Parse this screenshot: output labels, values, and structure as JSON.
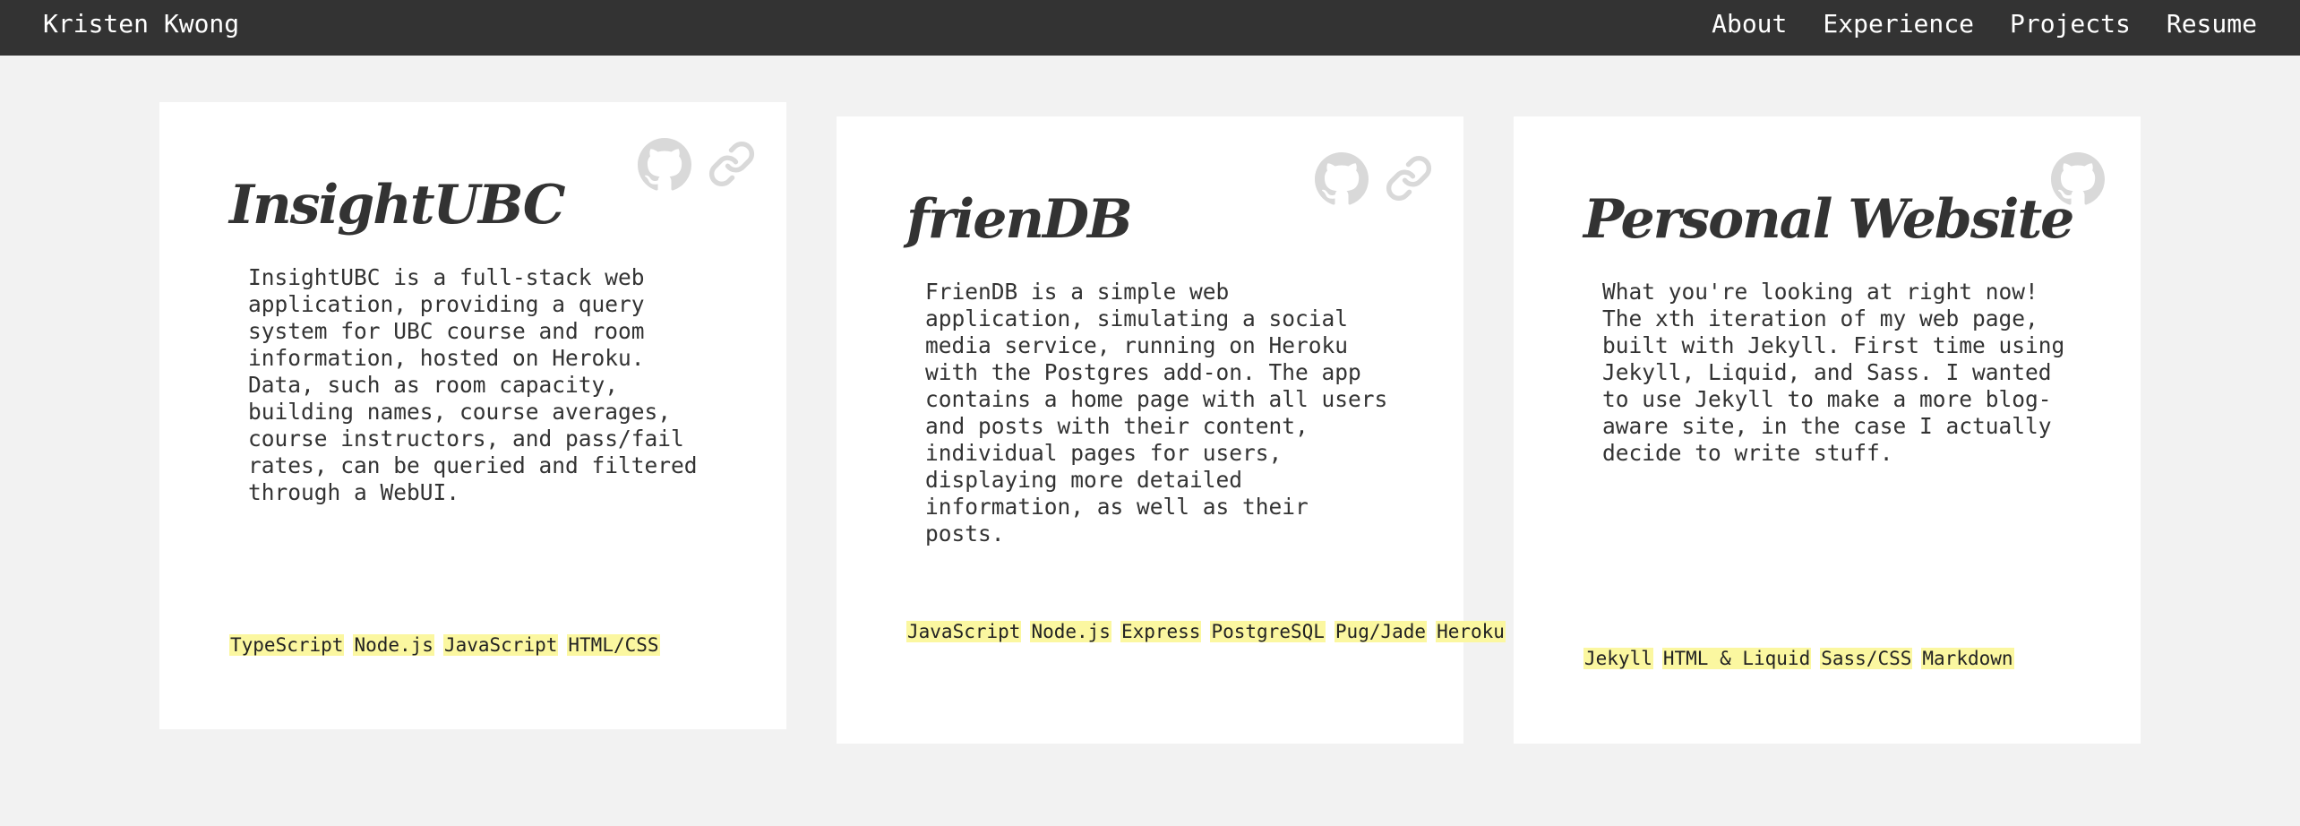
{
  "nav": {
    "brand": "Kristen Kwong",
    "links": [
      "About",
      "Experience",
      "Projects",
      "Resume"
    ]
  },
  "projects": [
    {
      "title": "InsightUBC",
      "description": "InsightUBC is a full-stack web application, providing a query system for UBC course and room information, hosted on Heroku. Data, such as room capacity, building names, course averages, course instructors, and pass/fail rates, can be queried and filtered through a WebUI.",
      "tags": [
        "TypeScript",
        "Node.js",
        "JavaScript",
        "HTML/CSS"
      ],
      "icons": [
        "github-icon",
        "link-icon"
      ]
    },
    {
      "title": "frienDB",
      "description": "FrienDB is a simple web application, simulating a social media service, running on Heroku with the Postgres add-on. The app contains a home page with all users and posts with their content, individual pages for users, displaying more detailed information, as well as their posts.",
      "tags": [
        "JavaScript",
        "Node.js",
        "Express",
        "PostgreSQL",
        "Pug/Jade",
        "Heroku"
      ],
      "icons": [
        "github-icon",
        "link-icon"
      ]
    },
    {
      "title": "Personal Website",
      "description": "What you're looking at right now! The xth iteration of my web page, built with Jekyll. First time using Jekyll, Liquid, and Sass. I wanted to use Jekyll to make a more blog-aware site, in the case I actually decide to write stuff.",
      "tags": [
        "Jekyll",
        "HTML & Liquid",
        "Sass/CSS",
        "Markdown"
      ],
      "icons": [
        "github-icon"
      ]
    }
  ],
  "colors": {
    "navbar": "#333333",
    "background": "#f2f2f2",
    "card": "#ffffff",
    "tag_highlight": "#fbf7a0",
    "icon": "#d9d9d9"
  }
}
